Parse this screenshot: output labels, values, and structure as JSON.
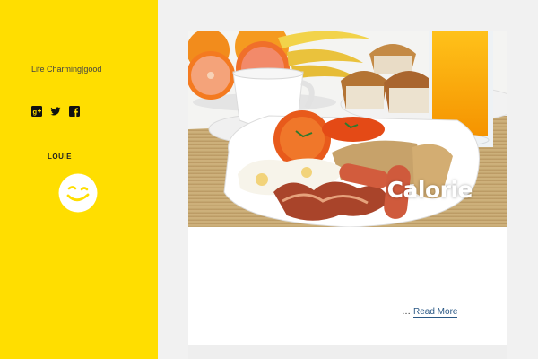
{
  "sidebar": {
    "tagline": "Life Charming|good",
    "social": [
      "google-plus-icon",
      "twitter-icon",
      "facebook-icon"
    ],
    "author_name": "LOUIE",
    "background_color": "#ffde00"
  },
  "post": {
    "title": "Calorie",
    "ellipsis": "…",
    "read_more": "Read More"
  }
}
